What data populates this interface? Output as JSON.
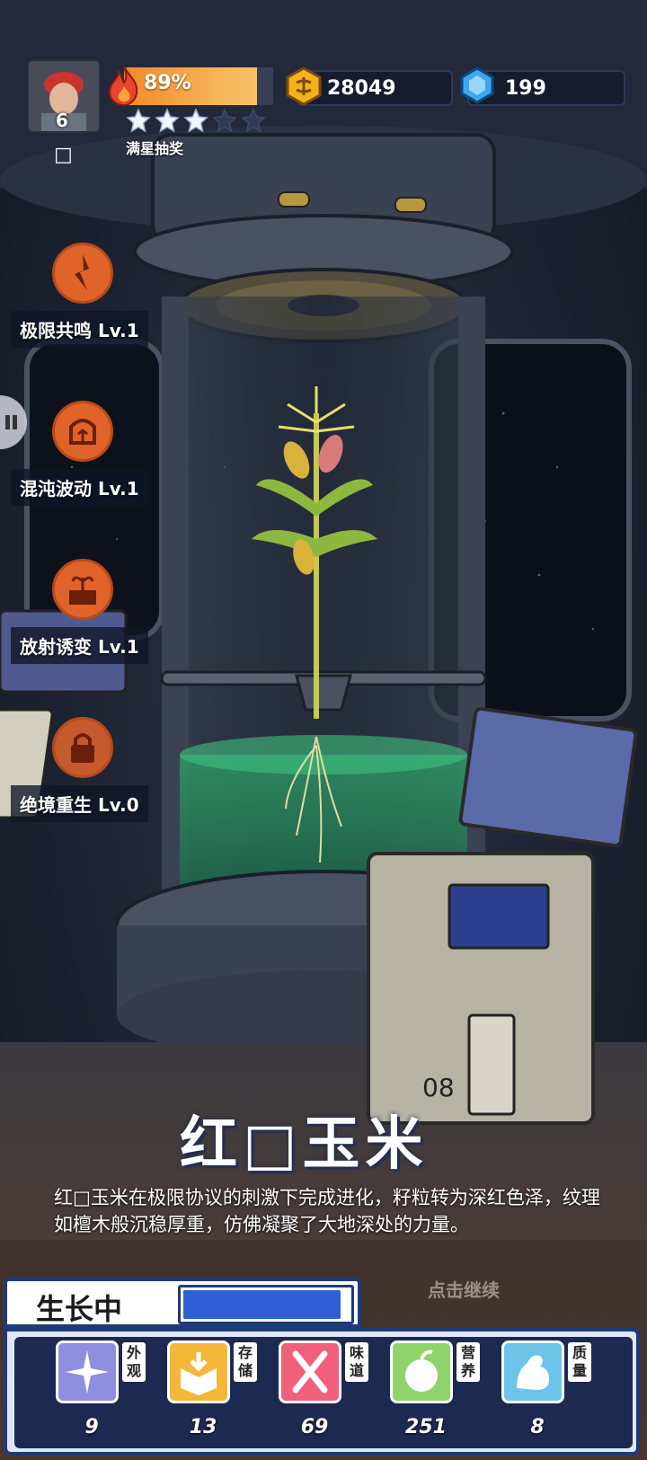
{
  "hud": {
    "level": "6",
    "energy_percent": 89,
    "energy_label": "89%",
    "stars_filled": 3,
    "stars_total": 5,
    "draw_label": "满星抽奖",
    "coins": "28049",
    "gems": "199",
    "small_square": "□"
  },
  "skills": [
    {
      "label": "极限共鸣 Lv.1",
      "icon": "resonance-icon"
    },
    {
      "label": "混沌波动 Lv.1",
      "icon": "chaos-icon"
    },
    {
      "label": "放射诱变 Lv.1",
      "icon": "radiation-icon"
    },
    {
      "label": "绝境重生 Lv.0",
      "icon": "lock-icon"
    }
  ],
  "plant": {
    "name": "红□玉米",
    "description": "红□玉米在极限协议的刺激下完成进化，籽粒转为深红色泽，纹理如檀木般沉稳厚重，仿佛凝聚了大地深处的力量。",
    "tap_hint": "点击继续"
  },
  "growth": {
    "status_label": "生长中",
    "progress": 0.95
  },
  "attributes": [
    {
      "tag": "外观",
      "value": "9",
      "icon": "sparkle-icon",
      "color": "#8f8fe0"
    },
    {
      "tag": "存储",
      "value": "13",
      "icon": "box-icon",
      "color": "#f4b73a"
    },
    {
      "tag": "味道",
      "value": "69",
      "icon": "utensils-icon",
      "color": "#f0607a"
    },
    {
      "tag": "营养",
      "value": "251",
      "icon": "fruit-icon",
      "color": "#8fd46a"
    },
    {
      "tag": "质量",
      "value": "8",
      "icon": "muscle-icon",
      "color": "#6cc4e8"
    }
  ],
  "colors": {
    "accent_orange": "#e0642a",
    "panel_blue": "#1f3a78",
    "progress_blue": "#2f5fd6"
  }
}
